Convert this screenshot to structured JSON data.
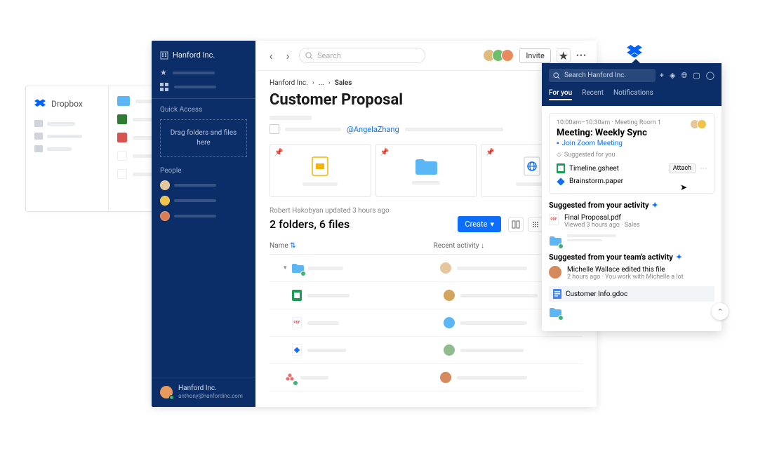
{
  "background": {
    "app_name": "Dropbox"
  },
  "sidebar": {
    "org": "Hanford Inc.",
    "quick_access_heading": "Quick Access",
    "dropzone_line1": "Drag folders and files",
    "dropzone_line2": "here",
    "people_heading": "People",
    "footer_org": "Hanford Inc.",
    "footer_email": "anthony@hanfordinc.com"
  },
  "topbar": {
    "search_placeholder": "Search",
    "invite_label": "Invite"
  },
  "breadcrumb": {
    "root": "Hanford Inc.",
    "mid": "...",
    "leaf": "Sales"
  },
  "page": {
    "title": "Customer Proposal",
    "mention": "@AngelaZhang",
    "update_text": "Robert Hakobyan updated 3 hours ago",
    "count_text": "2 folders, 6 files",
    "create_label": "Create",
    "col_name": "Name",
    "col_activity": "Recent activity"
  },
  "panel": {
    "search_placeholder": "Search Hanford Inc.",
    "tab_foryou": "For you",
    "tab_recent": "Recent",
    "tab_notifications": "Notifications",
    "meeting_time": "10:00am–10:30am · Meeting Room 1",
    "meeting_title": "Meeting: Weekly Sync",
    "zoom_label": "Join Zoom Meeting",
    "suggested_head": "Suggested for you",
    "file1": "Timeline.gsheet",
    "file2": "Brainstorm.paper",
    "attach_label": "Attach",
    "section_activity": "Suggested from your activity",
    "doc_pdf": "Final Proposal.pdf",
    "doc_pdf_meta": "Viewed 3 hours ago · Sales",
    "section_team": "Suggested from your team's activity",
    "team_edit": "Michelle Wallace edited this file",
    "team_meta": "2 hours ago · You work with Michelle a lot",
    "gdoc": "Customer Info.gdoc"
  }
}
